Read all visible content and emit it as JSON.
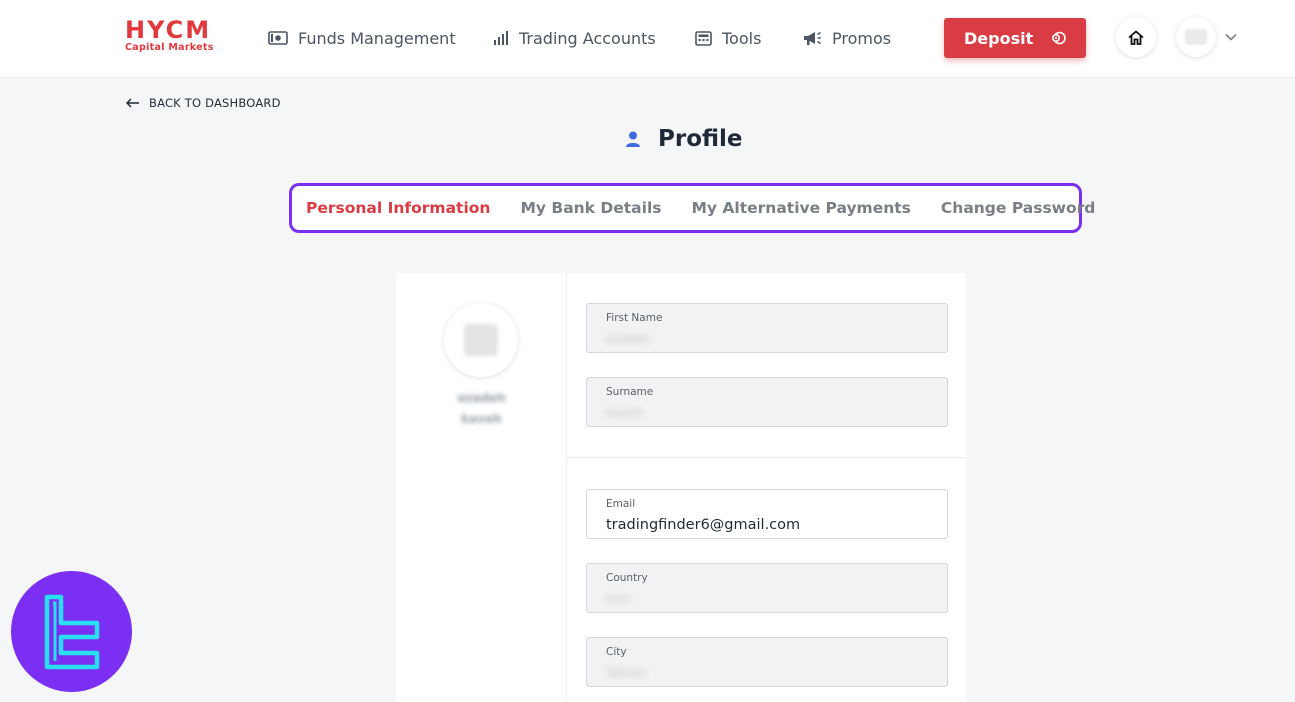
{
  "brand": {
    "name": "HYCM",
    "tagline": "Capital Markets"
  },
  "nav": [
    {
      "label": "Funds Management",
      "icon": "money-icon"
    },
    {
      "label": "Trading Accounts",
      "icon": "bar-chart-icon"
    },
    {
      "label": "Tools",
      "icon": "calculator-icon"
    },
    {
      "label": "Promos",
      "icon": "megaphone-icon"
    }
  ],
  "header": {
    "deposit_label": "Deposit"
  },
  "back": {
    "label": "BACK TO DASHBOARD"
  },
  "page": {
    "title": "Profile"
  },
  "tabs": [
    {
      "label": "Personal Information",
      "active": true
    },
    {
      "label": "My Bank Details",
      "active": false
    },
    {
      "label": "My Alternative Payments",
      "active": false
    },
    {
      "label": "Change Password",
      "active": false
    }
  ],
  "profile": {
    "first_name_display": "azadeh",
    "surname_display": "kaveh"
  },
  "fields": {
    "first_name": {
      "label": "First Name",
      "value": "azadeh"
    },
    "surname": {
      "label": "Surname",
      "value": "kaveh"
    },
    "email": {
      "label": "Email",
      "value": "tradingfinder6@gmail.com"
    },
    "country": {
      "label": "Country",
      "value": "Iran"
    },
    "city": {
      "label": "City",
      "value": "Tehran"
    }
  },
  "colors": {
    "accent": "#d93d43",
    "highlight": "#7b2ff2",
    "watermark": "#7b2ff2"
  }
}
